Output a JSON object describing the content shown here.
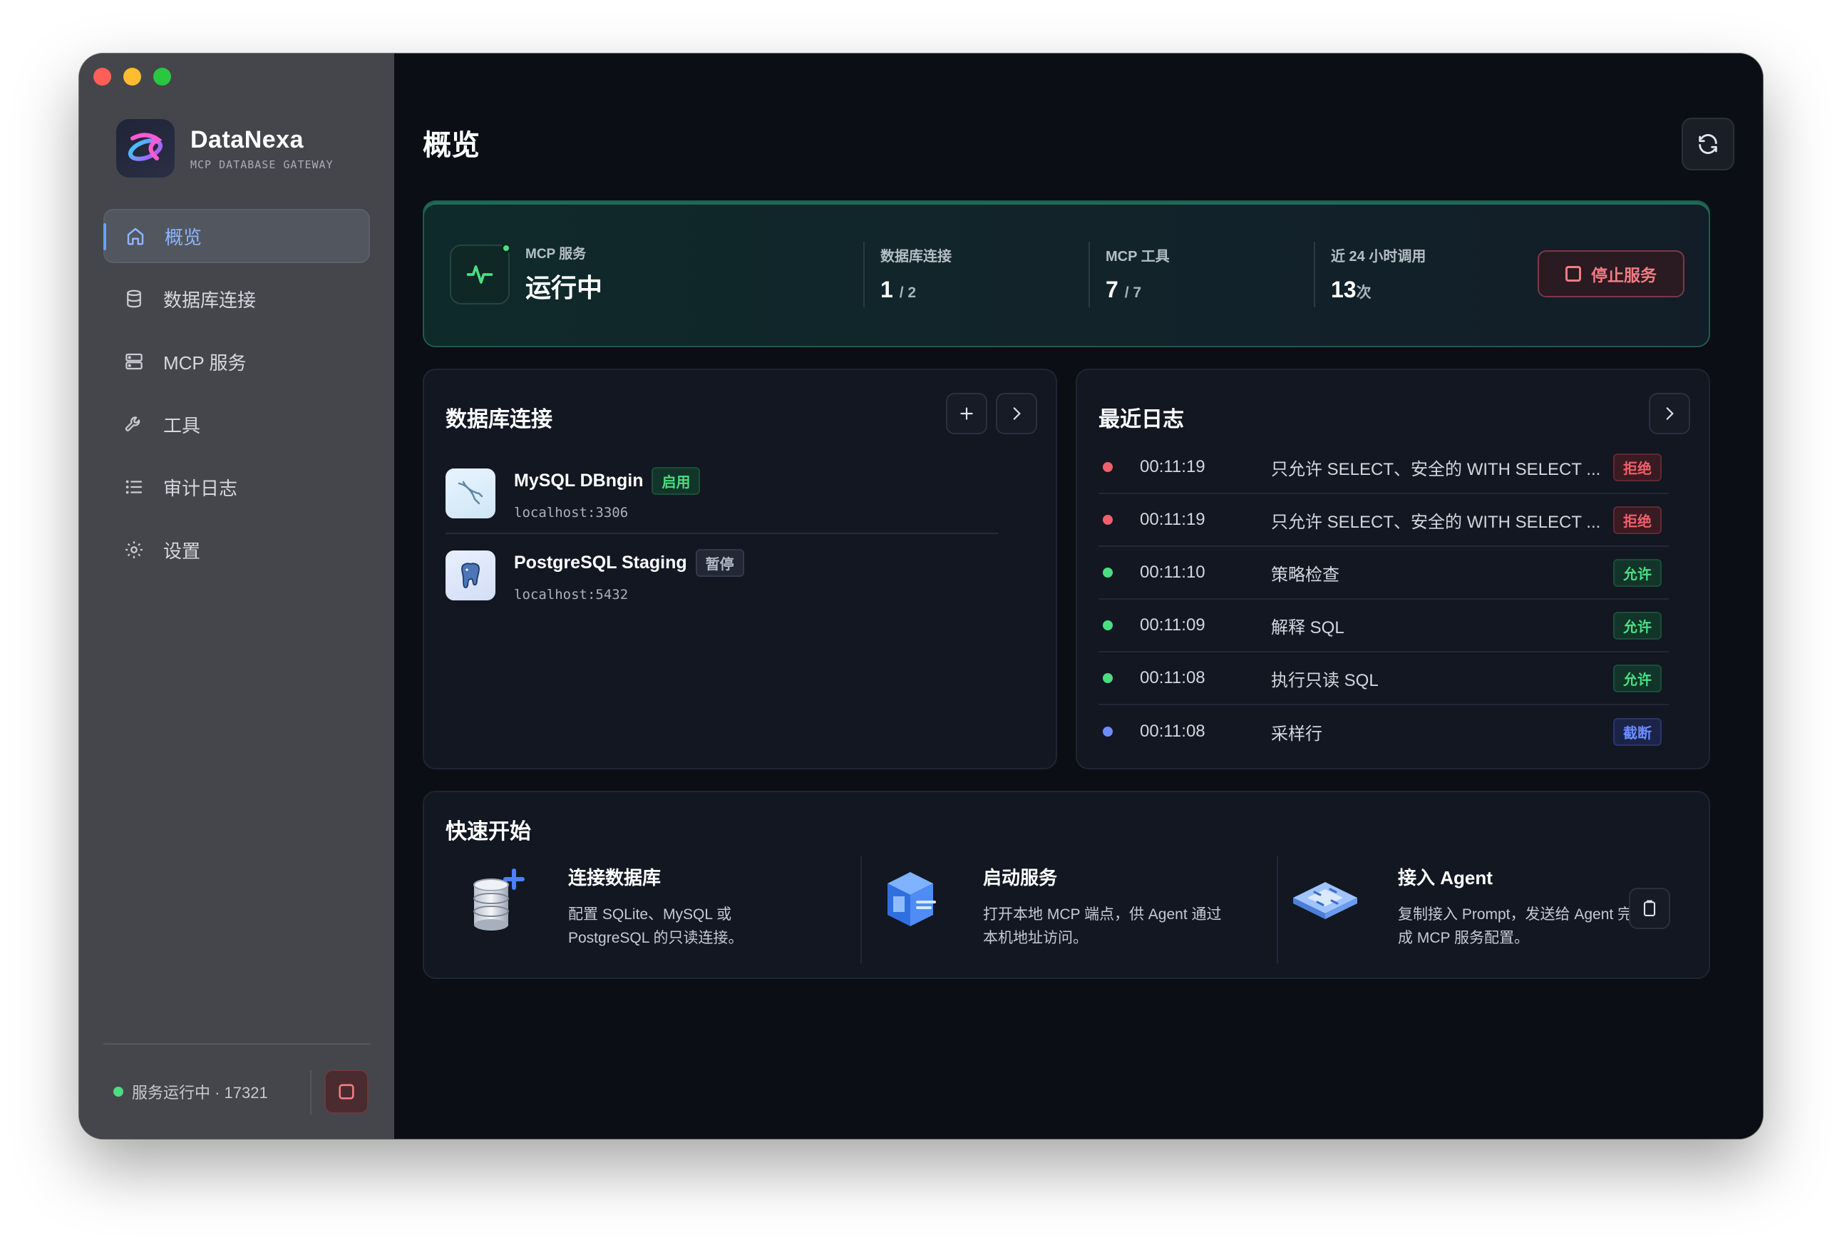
{
  "app": {
    "name": "DataNexa",
    "subtitle": "MCP DATABASE GATEWAY"
  },
  "sidebar": {
    "items": [
      {
        "label": "概览",
        "icon": "home-icon",
        "active": true
      },
      {
        "label": "数据库连接",
        "icon": "database-icon"
      },
      {
        "label": "MCP 服务",
        "icon": "server-icon"
      },
      {
        "label": "工具",
        "icon": "wrench-icon"
      },
      {
        "label": "审计日志",
        "icon": "list-icon"
      },
      {
        "label": "设置",
        "icon": "gear-icon"
      }
    ],
    "footer_status": "服务运行中 · 17321"
  },
  "page": {
    "title": "概览"
  },
  "status": {
    "service_label": "MCP 服务",
    "service_state": "运行中",
    "db_label": "数据库连接",
    "db_value": "1",
    "db_total": "/ 2",
    "tools_label": "MCP 工具",
    "tools_value": "7",
    "tools_total": "/ 7",
    "calls_label": "近 24 小时调用",
    "calls_value": "13",
    "calls_unit": "次",
    "stop_label": "停止服务"
  },
  "db_panel": {
    "title": "数据库连接",
    "rows": [
      {
        "name": "MySQL DBngin",
        "badge": "启用",
        "addr": "localhost:3306",
        "icon": "mysql-dolphin-icon"
      },
      {
        "name": "PostgreSQL Staging",
        "badge": "暂停",
        "addr": "localhost:5432",
        "icon": "postgresql-elephant-icon"
      }
    ]
  },
  "log_panel": {
    "title": "最近日志",
    "rows": [
      {
        "time": "00:11:19",
        "msg": "只允许 SELECT、安全的 WITH SELECT ...",
        "badge": "拒绝",
        "status": "red"
      },
      {
        "time": "00:11:19",
        "msg": "只允许 SELECT、安全的 WITH SELECT ...",
        "badge": "拒绝",
        "status": "red"
      },
      {
        "time": "00:11:10",
        "msg": "策略检查",
        "badge": "允许",
        "status": "green"
      },
      {
        "time": "00:11:09",
        "msg": "解释 SQL",
        "badge": "允许",
        "status": "green"
      },
      {
        "time": "00:11:08",
        "msg": "执行只读 SQL",
        "badge": "允许",
        "status": "green"
      },
      {
        "time": "00:11:08",
        "msg": "采样行",
        "badge": "截断",
        "status": "blue"
      }
    ]
  },
  "quickstart": {
    "title": "快速开始",
    "items": [
      {
        "title": "连接数据库",
        "desc": "配置 SQLite、MySQL 或 PostgreSQL 的只读连接。",
        "icon": "database-add-icon"
      },
      {
        "title": "启动服务",
        "desc": "打开本地 MCP 端点，供 Agent 通过本机地址访问。",
        "icon": "server-cube-icon"
      },
      {
        "title": "接入 Agent",
        "desc": "复制接入 Prompt，发送给 Agent 完成 MCP 服务配置。",
        "icon": "agent-chip-icon"
      }
    ]
  },
  "colors": {
    "accent": "#6d9cff",
    "success": "#4ade80",
    "danger": "#f05f6a",
    "info": "#6c8dff"
  }
}
